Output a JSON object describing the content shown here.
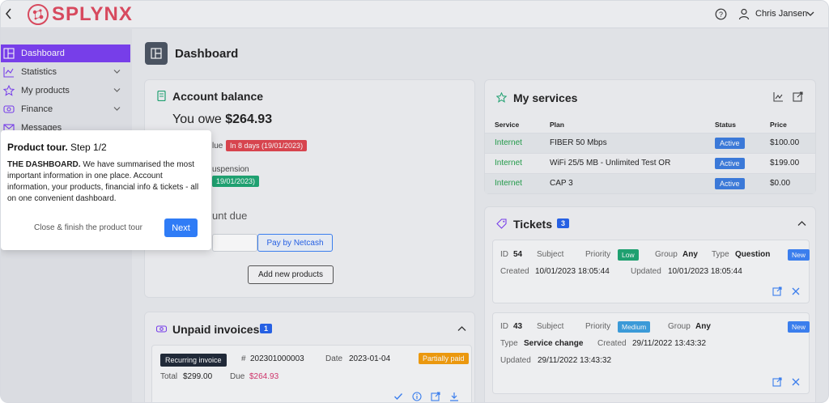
{
  "header": {
    "brand": "SPLYNX",
    "user_name": "Chris Jansen"
  },
  "sidebar": {
    "items": [
      {
        "label": "Dashboard",
        "icon": "dashboard-icon"
      },
      {
        "label": "Statistics",
        "icon": "chart-icon"
      },
      {
        "label": "My products",
        "icon": "star-icon"
      },
      {
        "label": "Finance",
        "icon": "money-icon"
      },
      {
        "label": "Messages",
        "icon": "mail-icon"
      }
    ]
  },
  "page": {
    "title": "Dashboard"
  },
  "balance": {
    "title": "Account balance",
    "owe_prefix": "You owe",
    "owe_amount": "$264.93",
    "frag_due": "lue",
    "due_badge": "In 8 days (19/01/2023)",
    "frag_susp": "uspension",
    "susp_badge": "19/01/2023)",
    "frag_amount": "unt due",
    "pay_button": "Pay by Netcash",
    "add_button": "Add new products"
  },
  "services": {
    "title": "My services",
    "columns": [
      "Service",
      "Plan",
      "Status",
      "Price"
    ],
    "rows": [
      {
        "service": "Internet",
        "plan": "FIBER 50 Mbps",
        "status": "Active",
        "price": "$100.00"
      },
      {
        "service": "Internet",
        "plan": "WiFi 25/5 MB - Unlimited Test OR",
        "status": "Active",
        "price": "$199.00"
      },
      {
        "service": "Internet",
        "plan": "CAP 3",
        "status": "Active",
        "price": "$0.00"
      }
    ]
  },
  "tickets": {
    "title": "Tickets",
    "count": "3",
    "labels": {
      "id": "ID",
      "subject": "Subject",
      "priority": "Priority",
      "group": "Group",
      "type": "Type",
      "created": "Created",
      "updated": "Updated"
    },
    "items": [
      {
        "id": "54",
        "priority": "Low",
        "group": "Any",
        "type": "Question",
        "status": "New",
        "created": "10/01/2023 18:05:44",
        "updated": "10/01/2023 18:05:44"
      },
      {
        "id": "43",
        "priority": "Medium",
        "group": "Any",
        "type": "Service change",
        "status": "New",
        "created": "29/11/2022 13:43:32",
        "updated": "29/11/2022 13:43:32"
      }
    ]
  },
  "invoices": {
    "title": "Unpaid invoices",
    "count": "1",
    "tag": "Recurring invoice",
    "hash": "#",
    "number": "202301000003",
    "date_label": "Date",
    "date": "2023-01-04",
    "status": "Partially paid",
    "total_label": "Total",
    "total": "$299.00",
    "due_label": "Due",
    "due": "$264.93"
  },
  "tour": {
    "title_bold": "Product tour.",
    "title_rest": " Step 1/2",
    "body_bold": "THE DASHBOARD.",
    "body_rest": " We have summarised the most important information in one place. Account information, your products, financial info & tickets - all on one convenient dashboard.",
    "close_label": "Close & finish the product tour",
    "next_label": "Next"
  },
  "colors": {
    "accent": "#7b3ff2",
    "brand": "#e04a5f",
    "link_green": "#22a04a",
    "active_blue": "#3b7de0",
    "danger": "#e0454f",
    "success": "#1ea672",
    "warning": "#f59e0b"
  }
}
